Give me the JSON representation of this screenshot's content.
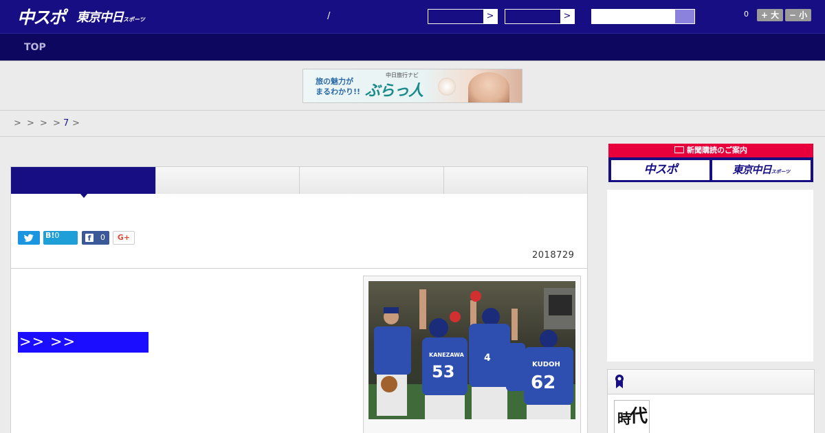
{
  "header": {
    "logo_chuspo": "中スポ",
    "logo_tokyo": "東京中日",
    "logo_tokyo_sub": "スポーツ",
    "separator": "/",
    "select1_arrow": ">",
    "select2_arrow": ">",
    "search_placeholder": "",
    "count": "0",
    "font_larger": "+ 大",
    "font_smaller": "− 小"
  },
  "nav": {
    "top": "TOP"
  },
  "banner": {
    "main_line1": "旅の魅力が",
    "main_line2": "まるわかり!!",
    "sub": "中日旅行ナビ",
    "logo": "ぶらっ人"
  },
  "breadcrumb": {
    "sep1": ">",
    "sep2": ">",
    "sep3": ">",
    "sep4": ">",
    "link": "7",
    "sep5": ">"
  },
  "article": {
    "share": {
      "hatena_label": "B!",
      "hatena_count": "0",
      "facebook_icon": "f",
      "facebook_count": "0",
      "gplus_label": "G+"
    },
    "date": "2018729",
    "more_link": ">> >>"
  },
  "sidebar": {
    "subscription_title": "新聞購読のご案内",
    "btn_chuspo": "中スポ",
    "btn_tokyo": "東京中日",
    "btn_tokyo_sub": "スポーツ",
    "rank_thumb_text1": "時",
    "rank_thumb_text2": "代"
  },
  "colors": {
    "header_bg": "#160e82",
    "nav_bg": "#0e0760",
    "accent_red": "#e8003c",
    "link_blue": "#1b0dff",
    "twitter": "#1b95e0",
    "facebook": "#3b5998"
  },
  "icons": [
    "twitter-icon",
    "facebook-icon",
    "chevron-right-icon",
    "ribbon-icon",
    "newspaper-icon"
  ]
}
